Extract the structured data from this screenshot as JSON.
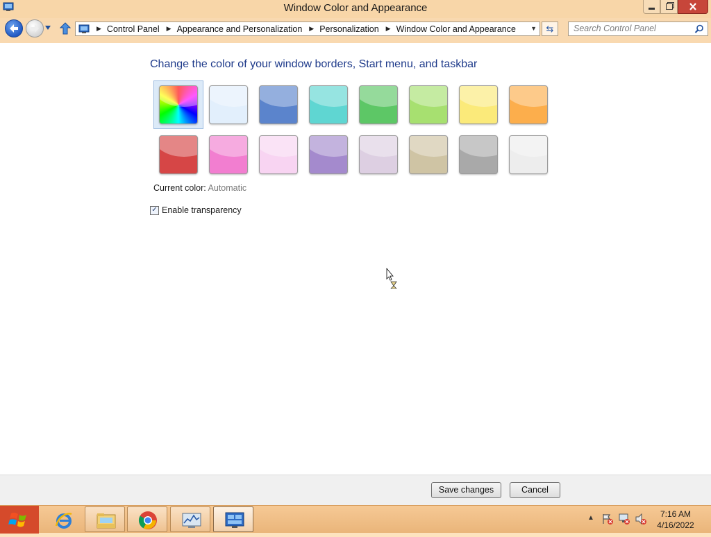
{
  "window": {
    "title": "Window Color and Appearance",
    "controls": {
      "minimize_icon": "minimize-icon",
      "restore_icon": "restore-icon",
      "close_icon": "close-icon"
    }
  },
  "nav": {
    "breadcrumbs": [
      "Control Panel",
      "Appearance and Personalization",
      "Personalization",
      "Window Color and Appearance"
    ],
    "search_placeholder": "Search Control Panel"
  },
  "content": {
    "heading": "Change the color of your window borders, Start menu, and taskbar",
    "swatches": [
      {
        "name": "automatic-rainbow",
        "color": "rainbow",
        "selected": true
      },
      {
        "name": "sky",
        "color": "#e2effc"
      },
      {
        "name": "blue",
        "color": "#5b84cc"
      },
      {
        "name": "teal",
        "color": "#5fd6d2"
      },
      {
        "name": "green",
        "color": "#5dc766"
      },
      {
        "name": "lime",
        "color": "#a7e070"
      },
      {
        "name": "yellow",
        "color": "#fbea7a"
      },
      {
        "name": "orange",
        "color": "#fcae4c"
      },
      {
        "name": "red",
        "color": "#d64646"
      },
      {
        "name": "pink",
        "color": "#f27ed0"
      },
      {
        "name": "light-pink",
        "color": "#f8d4f2"
      },
      {
        "name": "purple",
        "color": "#a48acd"
      },
      {
        "name": "lavender",
        "color": "#ddcfe2"
      },
      {
        "name": "taupe",
        "color": "#cfc4a4"
      },
      {
        "name": "gray",
        "color": "#a9a9a9"
      },
      {
        "name": "white",
        "color": "#ededed"
      }
    ],
    "current_color_label": "Current color:",
    "current_color_value": "Automatic",
    "transparency_label": "Enable transparency",
    "transparency_checked": true
  },
  "footer": {
    "save_label": "Save changes",
    "cancel_label": "Cancel"
  },
  "taskbar": {
    "items": [
      {
        "name": "internet-explorer",
        "icon": "ie-icon",
        "state": "pinned"
      },
      {
        "name": "file-explorer",
        "icon": "folder-icon",
        "state": "open"
      },
      {
        "name": "chrome",
        "icon": "chrome-icon",
        "state": "open"
      },
      {
        "name": "resource-monitor",
        "icon": "monitor-icon",
        "state": "open"
      },
      {
        "name": "control-panel",
        "icon": "control-panel-icon",
        "state": "active"
      }
    ],
    "time": "7:16 AM",
    "date": "4/16/2022"
  }
}
